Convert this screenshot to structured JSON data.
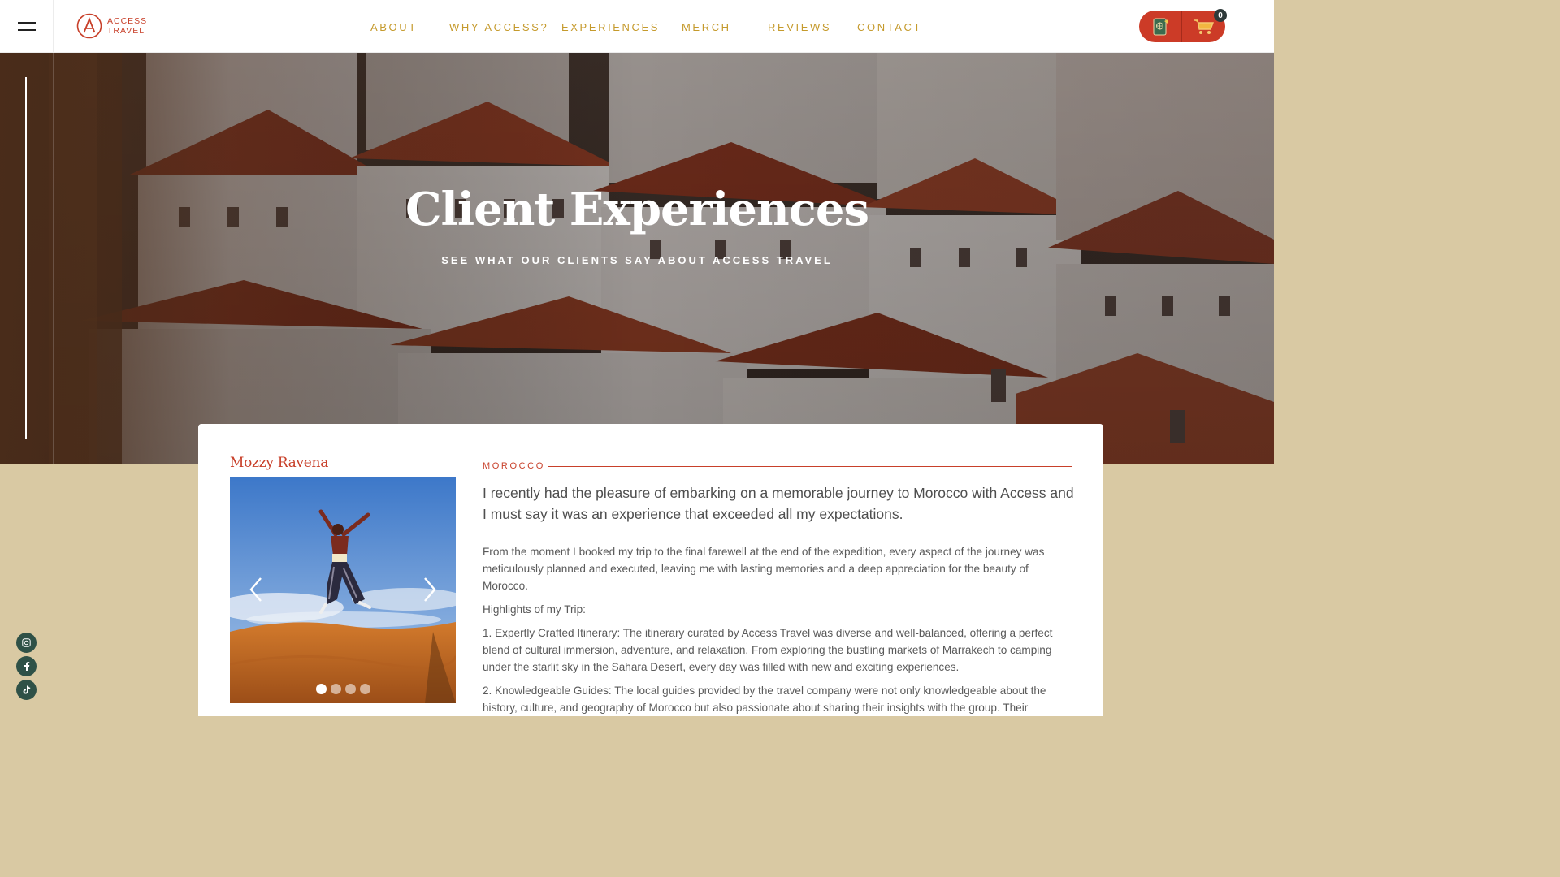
{
  "header": {
    "logo": {
      "line1": "ACCESS",
      "line2": "TRAVEL"
    },
    "nav": [
      {
        "label": "ABOUT"
      },
      {
        "label": "WHY ACCESS?"
      },
      {
        "label": "EXPERIENCES"
      },
      {
        "label": "MERCH"
      },
      {
        "label": "REVIEWS"
      },
      {
        "label": "CONTACT"
      }
    ],
    "cart_count": "0"
  },
  "hero": {
    "title": "Client Experiences",
    "subtitle": "SEE WHAT OUR CLIENTS SAY ABOUT ACCESS TRAVEL"
  },
  "review": {
    "reviewer": "Mozzy Ravena",
    "country": "MOROCCO",
    "lead": "I recently had the pleasure of embarking on a memorable journey to Morocco with Access and I must say it was an experience that exceeded all my expectations.",
    "paragraph1": "From the moment I booked my trip to the final farewell at the end of the expedition, every aspect of the journey was meticulously planned and executed, leaving me with lasting memories and a deep appreciation for the beauty of Morocco.",
    "highlights_title": "Highlights of my Trip:",
    "highlight1": "1. Expertly Crafted Itinerary: The itinerary curated by Access Travel was diverse and well-balanced, offering a perfect blend of cultural immersion, adventure, and relaxation. From exploring the bustling markets of Marrakech to camping under the starlit sky in the Sahara Desert, every day was filled with new and exciting experiences.",
    "highlight2": "2. Knowledgeable Guides: The local guides provided by the travel company were not only knowledgeable about the history, culture, and geography of Morocco but also passionate about sharing their insights with the group. Their",
    "slider": {
      "total": 4,
      "active": 1
    }
  },
  "colors": {
    "accent_red": "#c8402a",
    "nav_gold": "#c59a2c",
    "page_tan": "#d9c9a3",
    "social_green": "#2f5147"
  },
  "icons": {
    "menu": "hamburger-icon",
    "passport": "passport-icon",
    "cart": "cart-icon",
    "instagram": "instagram-icon",
    "facebook": "facebook-icon",
    "tiktok": "tiktok-icon",
    "prev": "chevron-left-icon",
    "next": "chevron-right-icon"
  }
}
